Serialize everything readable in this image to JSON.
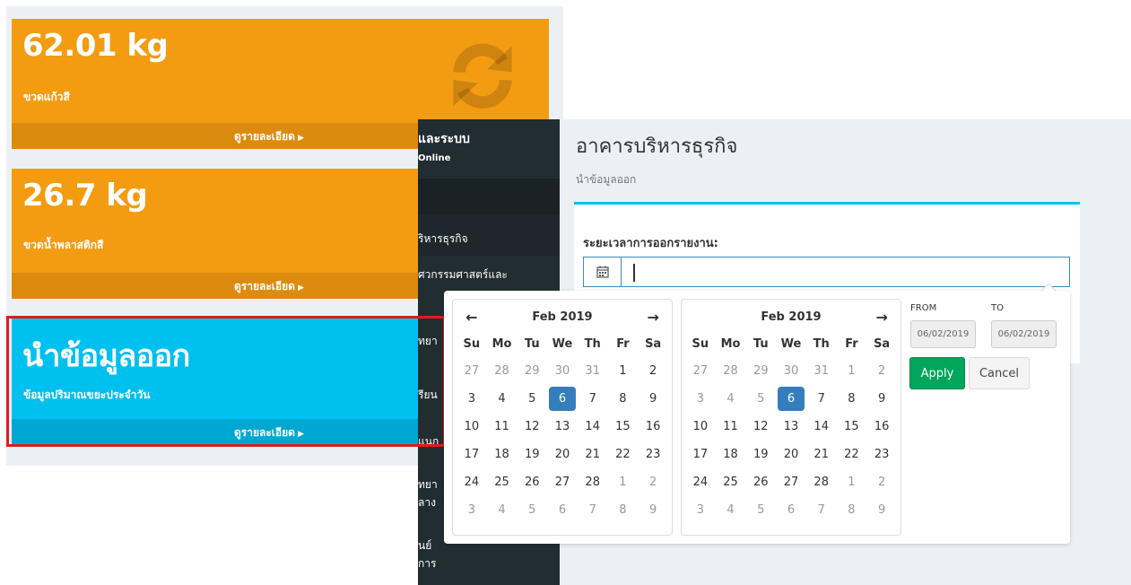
{
  "dashboard": {
    "boxes": [
      {
        "value": "62.01 kg",
        "label": "ขวดแก้วสี",
        "footer": "ดูรายละเอียด"
      },
      {
        "value": "26.7 kg",
        "label": "ขวดน้ำพลาสติกสี",
        "footer": "ดูรายละเอียด"
      },
      {
        "value": "นำข้อมูลออก",
        "label": "ข้อมูลปริมาณขยะประจำวัน",
        "footer": "ดูรายละเอียด"
      }
    ]
  },
  "sidebar": {
    "brand": "ูและระบบ",
    "status": "Online",
    "items": [
      "ริหารธุรกิจ",
      "ศวกรรมศาสตร์และ",
      "ทยา",
      "รียน",
      "แนก",
      "ทยา",
      "ลาง",
      "นย์",
      "การ"
    ]
  },
  "content": {
    "title": "อาคารบริหารธุรกิจ",
    "breadcrumb": "นำข้อมูลออก",
    "field_label": "ระยะเวลาการออกรายงาน:",
    "input_value": ""
  },
  "datepicker": {
    "left_month": "Feb 2019",
    "right_month": "Feb 2019",
    "weekdays": [
      "Su",
      "Mo",
      "Tu",
      "We",
      "Th",
      "Fr",
      "Sa"
    ],
    "left_days": [
      [
        "27",
        "28",
        "29",
        "30",
        "31",
        "1",
        "2"
      ],
      [
        "3",
        "4",
        "5",
        "6",
        "7",
        "8",
        "9"
      ],
      [
        "10",
        "11",
        "12",
        "13",
        "14",
        "15",
        "16"
      ],
      [
        "17",
        "18",
        "19",
        "20",
        "21",
        "22",
        "23"
      ],
      [
        "24",
        "25",
        "26",
        "27",
        "28",
        "1",
        "2"
      ],
      [
        "3",
        "4",
        "5",
        "6",
        "7",
        "8",
        "9"
      ]
    ],
    "right_days": [
      [
        "27",
        "28",
        "29",
        "30",
        "31",
        "1",
        "2"
      ],
      [
        "3",
        "4",
        "5",
        "6",
        "7",
        "8",
        "9"
      ],
      [
        "10",
        "11",
        "12",
        "13",
        "14",
        "15",
        "16"
      ],
      [
        "17",
        "18",
        "19",
        "20",
        "21",
        "22",
        "23"
      ],
      [
        "24",
        "25",
        "26",
        "27",
        "28",
        "1",
        "2"
      ],
      [
        "3",
        "4",
        "5",
        "6",
        "7",
        "8",
        "9"
      ]
    ],
    "left_offmonth": [
      [
        0,
        0
      ],
      [
        0,
        1
      ],
      [
        0,
        2
      ],
      [
        0,
        3
      ],
      [
        0,
        4
      ],
      [
        4,
        5
      ],
      [
        4,
        6
      ],
      [
        5,
        0
      ],
      [
        5,
        1
      ],
      [
        5,
        2
      ],
      [
        5,
        3
      ],
      [
        5,
        4
      ],
      [
        5,
        5
      ],
      [
        5,
        6
      ]
    ],
    "right_offmonth": [
      [
        0,
        0
      ],
      [
        0,
        1
      ],
      [
        0,
        2
      ],
      [
        0,
        3
      ],
      [
        0,
        4
      ],
      [
        0,
        5
      ],
      [
        0,
        6
      ],
      [
        1,
        0
      ],
      [
        1,
        1
      ],
      [
        1,
        2
      ],
      [
        4,
        5
      ],
      [
        4,
        6
      ],
      [
        5,
        0
      ],
      [
        5,
        1
      ],
      [
        5,
        2
      ],
      [
        5,
        3
      ],
      [
        5,
        4
      ],
      [
        5,
        5
      ],
      [
        5,
        6
      ]
    ],
    "selected": [
      1,
      3
    ],
    "from_label": "FROM",
    "to_label": "TO",
    "from_value": "06/02/2019",
    "to_value": "06/02/2019",
    "apply_label": "Apply",
    "cancel_label": "Cancel"
  },
  "colors": {
    "orange": "#f39c12",
    "cyan": "#00c0ef",
    "sidebar": "#222d32",
    "selected": "#357ebd",
    "apply": "#00a65a",
    "highlight": "#e01b1b"
  }
}
